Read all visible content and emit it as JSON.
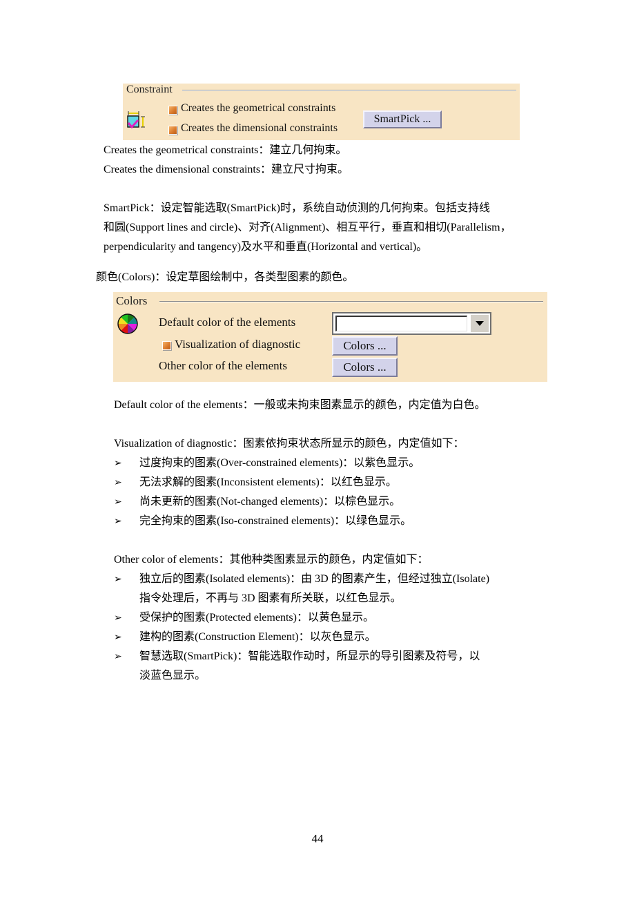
{
  "constraint_panel": {
    "title": "Constraint",
    "icon": "constraint-icon",
    "options": [
      {
        "label": "Creates the geometrical constraints",
        "checked": true
      },
      {
        "label": "Creates the dimensional constraints",
        "checked": true
      }
    ],
    "smartpick_button": "SmartPick ..."
  },
  "constraint_desc": {
    "geometrical": "Creates the geometrical constraints：建立几何拘束。",
    "dimensional": "Creates the dimensional constraints：建立尺寸拘束。",
    "smartpick_lines": [
      "SmartPick：设定智能选取(SmartPick)时，系统自动侦测的几何拘束。包括支持线",
      "和圆(Support lines and circle)、对齐(Alignment)、相互平行，垂直和相切(Parallelism，",
      "perpendicularity and tangency)及水平和垂直(Horizontal and vertical)。"
    ]
  },
  "colors_heading": "颜色(Colors)：设定草图绘制中，各类型图素的颜色。",
  "colors_panel": {
    "title": "Colors",
    "icon": "color-wheel-icon",
    "default_label": "Default color of the elements",
    "default_value": "",
    "diagnostic_label": "Visualization of diagnostic",
    "diagnostic_checked": true,
    "diagnostic_button": "Colors ...",
    "other_label": "Other color of the elements",
    "other_button": "Colors ..."
  },
  "colors_desc": {
    "default": "Default color of the elements：一般或未拘束图素显示的颜色，内定值为白色。",
    "diagnostic_intro": "Visualization of diagnostic：图素依拘束状态所显示的颜色，内定值如下：",
    "diagnostic_items": [
      "过度拘束的图素(Over-constrained elements)：以紫色显示。",
      "无法求解的图素(Inconsistent elements)：以红色显示。",
      "尚未更新的图素(Not-changed elements)：以棕色显示。",
      "完全拘束的图素(Iso-constrained elements)：以绿色显示。"
    ],
    "other_intro": "Other color of elements：其他种类图素显示的颜色，内定值如下：",
    "other_items": [
      [
        "独立后的图素(Isolated elements)：由 3D 的图素产生，但经过独立(Isolate)",
        "指令处理后，不再与 3D 图素有所关联，以红色显示。"
      ],
      [
        "受保护的图素(Protected elements)：以黄色显示。"
      ],
      [
        "建构的图素(Construction Element)：以灰色显示。"
      ],
      [
        "智慧选取(SmartPick)：智能选取作动时，所显示的导引图素及符号，以",
        "淡蓝色显示。"
      ]
    ],
    "bullet": "➢"
  },
  "page_number": "44"
}
